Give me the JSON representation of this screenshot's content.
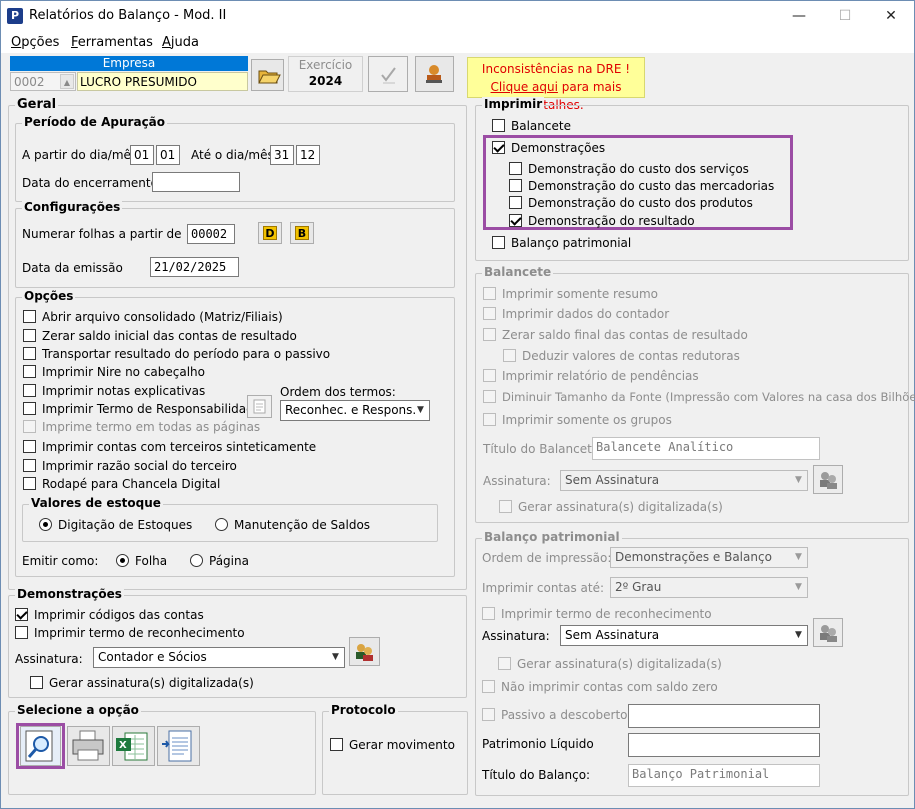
{
  "window": {
    "title": "Relatórios do Balanço - Mod. II",
    "minimize": "—",
    "maximize": "☐",
    "close": "✕"
  },
  "menu": [
    {
      "hot": "O",
      "rest": "pções"
    },
    {
      "hot": "F",
      "rest": "erramentas"
    },
    {
      "hot": "A",
      "rest": "juda"
    }
  ],
  "empresa": {
    "header": "Empresa",
    "code": "0002",
    "name": "LUCRO PRESUMIDO"
  },
  "exercicio": {
    "label": "Exercício",
    "year": "2024"
  },
  "alert": {
    "line1": "Inconsistências na DRE !",
    "link": "Clique aqui",
    "rest": " para mais detalhes."
  },
  "geral": {
    "title": "Geral",
    "periodo": {
      "title": "Período de Apuração",
      "from_label": "A partir do dia/mês",
      "from_day": "01",
      "from_month": "01",
      "to_label": "Até o dia/mês",
      "to_day": "31",
      "to_month": "12",
      "closing_label": "Data do encerramento",
      "closing_value": ""
    },
    "config": {
      "title": "Configurações",
      "number_label": "Numerar folhas a partir de",
      "number_value": "00002",
      "btn_d": "D",
      "btn_b": "B",
      "emission_label": "Data da emissão",
      "emission_value": "21/02/2025"
    },
    "opcoes": {
      "title": "Opções",
      "items": [
        {
          "label": "Abrir arquivo consolidado (Matriz/Filiais)",
          "checked": false,
          "enabled": true
        },
        {
          "label": "Zerar saldo inicial das contas de resultado",
          "checked": false,
          "enabled": true
        },
        {
          "label": "Transportar resultado do período para o passivo",
          "checked": false,
          "enabled": true
        },
        {
          "label": "Imprimir Nire no cabeçalho",
          "checked": false,
          "enabled": true
        },
        {
          "label": "Imprimir notas explicativas",
          "checked": false,
          "enabled": true
        },
        {
          "label": "Imprimir Termo de Responsabilidade",
          "checked": false,
          "enabled": true
        },
        {
          "label": "Imprime termo em todas as páginas",
          "checked": false,
          "enabled": false
        },
        {
          "label": "Imprimir contas com terceiros sinteticamente",
          "checked": false,
          "enabled": true
        },
        {
          "label": "Imprimir razão social do terceiro",
          "checked": false,
          "enabled": true
        },
        {
          "label": "Rodapé para Chancela Digital",
          "checked": false,
          "enabled": true
        }
      ],
      "ordem_label": "Ordem dos termos:",
      "ordem_value": "Reconhec. e Respons.",
      "estoque": {
        "title": "Valores de estoque",
        "opt1": "Digitação de Estoques",
        "opt2": "Manutenção de Saldos"
      },
      "emitir_label": "Emitir como:",
      "emitir_opt1": "Folha",
      "emitir_opt2": "Página"
    }
  },
  "demonstracoes": {
    "title": "Demonstrações",
    "codigos": "Imprimir códigos das contas",
    "termo": "Imprimir termo de reconhecimento",
    "assinatura_label": "Assinatura:",
    "assinatura_value": "Contador e Sócios",
    "gerar": "Gerar assinatura(s) digitalizada(s)"
  },
  "selecione": {
    "title": "Selecione a opção"
  },
  "protocolo": {
    "title": "Protocolo",
    "gerar": "Gerar movimento"
  },
  "imprimir": {
    "title": "Imprimir",
    "balancete": "Balancete",
    "demonstracoes": "Demonstrações",
    "subitems": [
      {
        "label": "Demonstração do custo dos serviços",
        "checked": false
      },
      {
        "label": "Demonstração do custo das mercadorias",
        "checked": false
      },
      {
        "label": "Demonstração do custo dos produtos",
        "checked": false
      },
      {
        "label": "Demonstração do resultado",
        "checked": true
      }
    ],
    "balanco": "Balanço patrimonial"
  },
  "balancete": {
    "title": "Balancete",
    "items": [
      "Imprimir somente resumo",
      "Imprimir dados do contador",
      "Zerar saldo final das contas de resultado",
      "Deduzir valores de contas redutoras",
      "Imprimir relatório de pendências",
      "Diminuir Tamanho da Fonte (Impressão com Valores na casa dos Bilhões)",
      "Imprimir somente os grupos"
    ],
    "titulo_label": "Título do Balancete:",
    "titulo_value": "Balancete Analítico",
    "assinatura_label": "Assinatura:",
    "assinatura_value": "Sem Assinatura",
    "gerar": "Gerar assinatura(s) digitalizada(s)"
  },
  "balanco": {
    "title": "Balanço patrimonial",
    "ordem_label": "Ordem de impressão:",
    "ordem_value": "Demonstrações e Balanço",
    "contas_label": "Imprimir contas até:",
    "contas_value": "2º Grau",
    "termo": "Imprimir termo de reconhecimento",
    "assinatura_label": "Assinatura:",
    "assinatura_value": "Sem Assinatura",
    "gerar": "Gerar assinatura(s) digitalizada(s)",
    "nao_imprimir": "Não imprimir contas com saldo zero",
    "passivo": "Passivo a descoberto",
    "pl_label": "Patrimonio Líquido",
    "titulo_label": "Título do Balanço:",
    "titulo_value": "Balanço Patrimonial"
  },
  "colors": {
    "highlight": "#9b4da4",
    "alert_bg": "#ffff99",
    "alert_text": "#e00000",
    "empresa_header": "#0078d7"
  }
}
